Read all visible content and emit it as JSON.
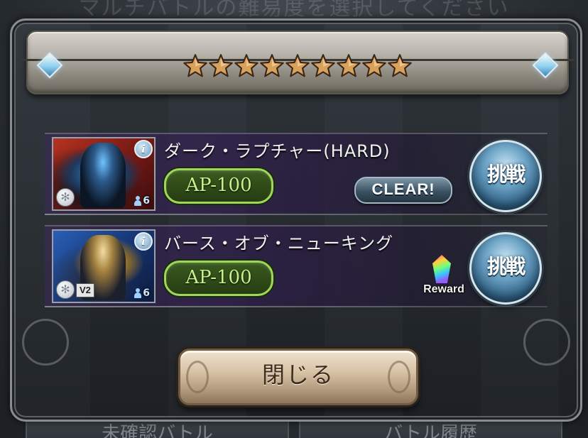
{
  "background": {
    "header_text": "マルチバトルの難易度を選択してください",
    "footer_buttons": [
      "未確認バトル",
      "バトル履歴"
    ]
  },
  "dialog": {
    "difficulty_stars": 9,
    "quests": [
      {
        "title": "ダーク・ラプチャー(HARD)",
        "ap_cost": "AP-100",
        "party_size": "6",
        "element_icon": "wind-element-icon",
        "status_badge": "CLEAR!",
        "challenge_label": "挑戦"
      },
      {
        "title": "バース・オブ・ニューキング",
        "ap_cost": "AP-100",
        "party_size": "6",
        "element_icon": "wind-element-icon",
        "version_badge": "V2",
        "reward_label": "Reward",
        "challenge_label": "挑戦"
      }
    ],
    "close_label": "閉じる"
  },
  "colors": {
    "ap_border": "#9ed85a",
    "ap_text": "#c8f08a",
    "challenge_button": "#6fa6c8",
    "star": "#d9a25c"
  }
}
